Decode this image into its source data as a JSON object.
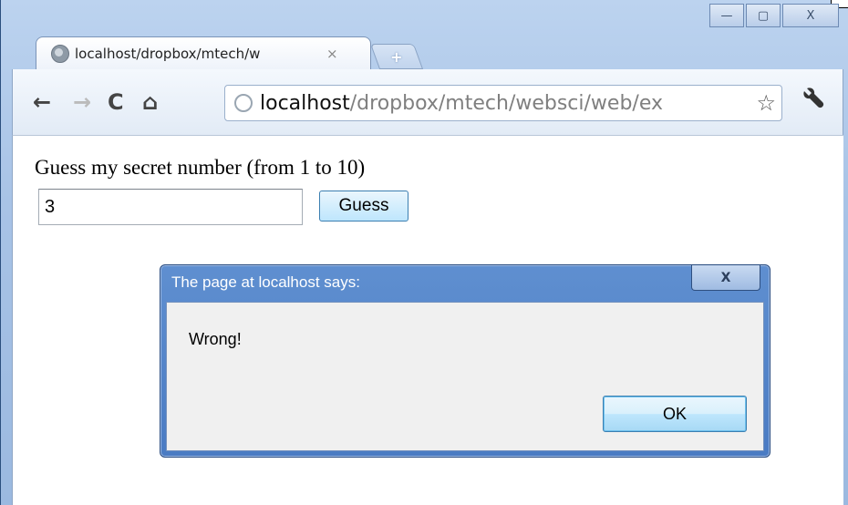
{
  "window": {
    "controls": {
      "minimize": "—",
      "maximize": "▢",
      "close": "X"
    }
  },
  "tab": {
    "title": "localhost/dropbox/mtech/w",
    "close": "×",
    "new_tab": "+"
  },
  "toolbar": {
    "back": "←",
    "forward": "→",
    "reload": "C",
    "home": "⌂",
    "url_host": "localhost",
    "url_path": "/dropbox/mtech/websci/web/ex",
    "star": "☆",
    "wrench": "🔧"
  },
  "page": {
    "prompt": "Guess my secret number (from 1 to 10)",
    "input_value": "3",
    "guess_label": "Guess"
  },
  "dialog": {
    "title": "The page at localhost says:",
    "close": "X",
    "message": "Wrong!",
    "ok_label": "OK"
  }
}
